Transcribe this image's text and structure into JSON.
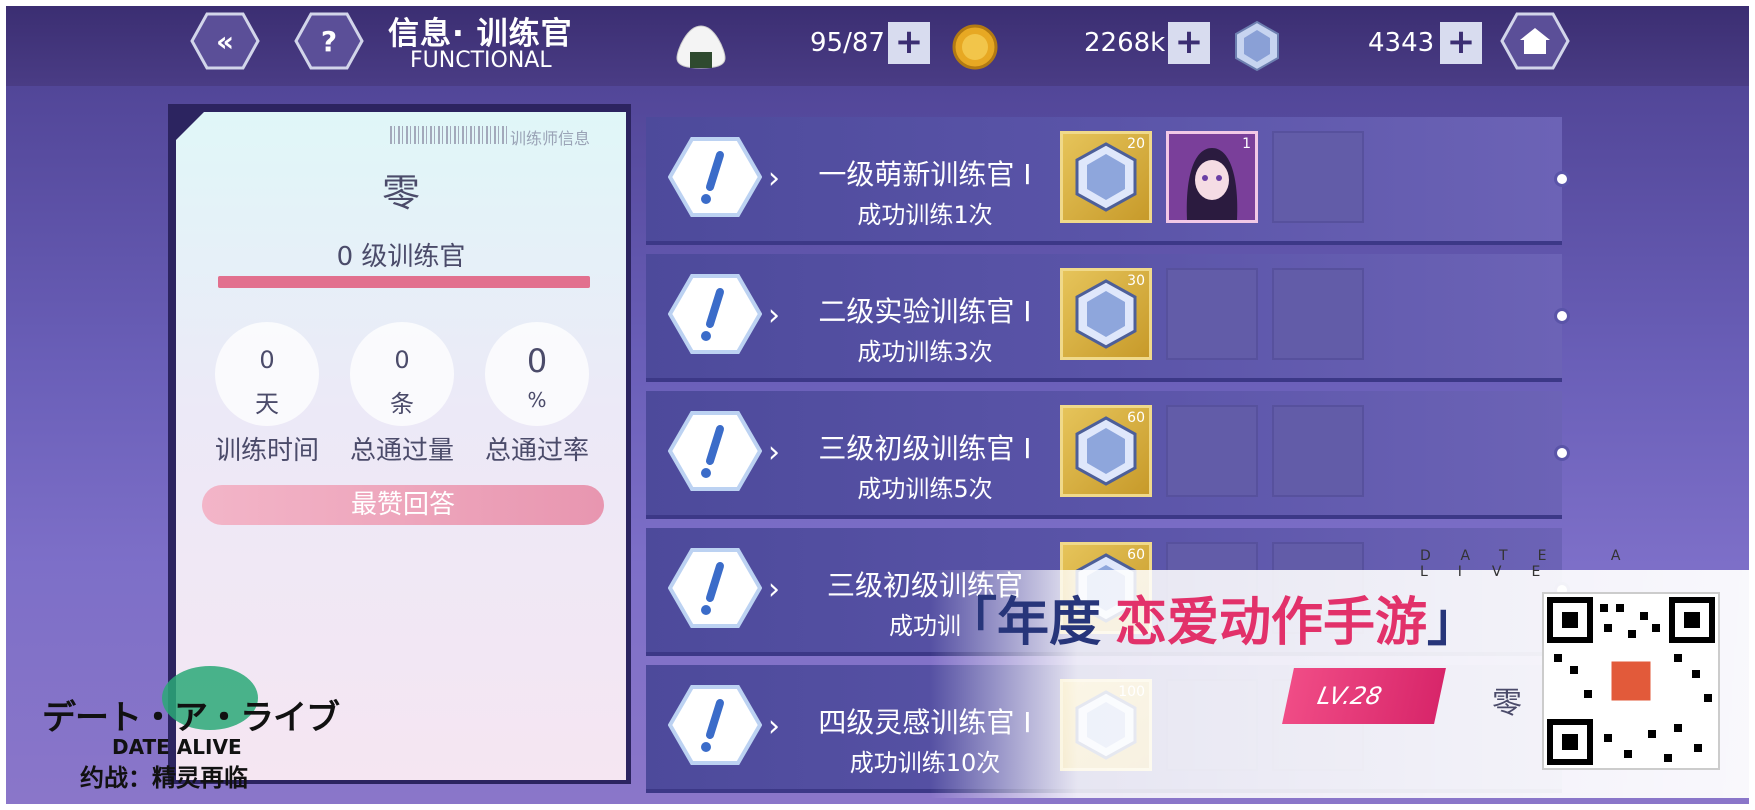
{
  "header": {
    "title_cn": "信息· 训练官",
    "title_en": "FUNCTIONAL",
    "stamina": "95/87",
    "coins": "2268k",
    "crystals": "4343"
  },
  "trainer_card": {
    "card_label": "训练师信息",
    "name": "零",
    "level_text": "0 级训练官",
    "xp_fraction": 1.0,
    "stats": [
      {
        "value": "0",
        "unit": "天",
        "label": "训练时间"
      },
      {
        "value": "0",
        "unit": "条",
        "label": "总通过量"
      },
      {
        "value": "0",
        "unit": "%",
        "label": "总通过率"
      }
    ],
    "best_answer_label": "最赞回答"
  },
  "achievements": [
    {
      "title": "一级萌新训练官 I",
      "requirement": "成功训练1次",
      "reward_count": "20",
      "extra_reward": "1"
    },
    {
      "title": "二级实验训练官 I",
      "requirement": "成功训练3次",
      "reward_count": "30"
    },
    {
      "title": "三级初级训练官 I",
      "requirement": "成功训练5次",
      "reward_count": "60"
    },
    {
      "title": "三级初级训练官",
      "requirement": "成功训",
      "reward_count": "60"
    },
    {
      "title": "四级灵感训练官 I",
      "requirement": "成功训练10次",
      "reward_count": "100"
    }
  ],
  "promo": {
    "tagline_open": "「",
    "tagline_a": "年度",
    "tagline_b": "恋爱动作手游",
    "tagline_close": "」",
    "series": "DATE A LIVE",
    "level_badge": "LV.28",
    "player_name": "零"
  },
  "logo": {
    "jp": "デート・ア・ライブ",
    "en": "DATE ALIVE",
    "cn": "约战：精灵再临"
  },
  "colors": {
    "accent_pink": "#e2316a",
    "navy": "#27357a",
    "gold": "#e6c45a"
  }
}
